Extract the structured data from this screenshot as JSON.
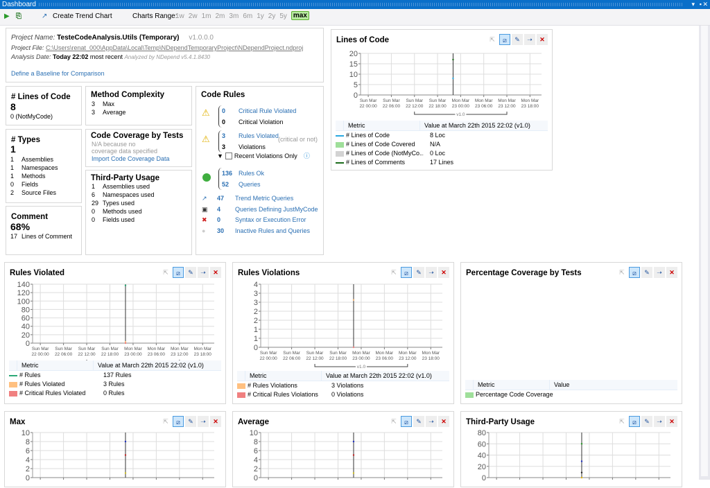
{
  "window": {
    "title": "Dashboard"
  },
  "toolbar": {
    "create_trend_chart": "Create Trend Chart",
    "charts_range_label": "Charts Range:",
    "ranges": [
      "1w",
      "2w",
      "1m",
      "2m",
      "3m",
      "6m",
      "1y",
      "2y",
      "5y",
      "max"
    ],
    "active_range": "max"
  },
  "project": {
    "name_label": "Project Name:",
    "name": "TesteCodeAnalysis.Utils (Temporary)",
    "version": "v1.0.0.0",
    "file_label": "Project File:",
    "file": "C:\\Users\\renat_000\\AppData\\Local\\Temp\\NDependTemporaryProject\\NDependProject.ndproj",
    "date_label": "Analysis Date:",
    "date": "Today 22:02",
    "recent": "most recent",
    "analyzed_by": "Analyzed by NDepend v5.4.1.8430",
    "baseline_link": "Define a Baseline for Comparison"
  },
  "loc": {
    "title": "# Lines of Code",
    "value": "8",
    "sub": "0  (NotMyCode)"
  },
  "types": {
    "title": "# Types",
    "value": "1",
    "rows": [
      [
        "1",
        "Assemblies"
      ],
      [
        "1",
        "Namespaces"
      ],
      [
        "1",
        "Methods"
      ],
      [
        "0",
        "Fields"
      ],
      [
        "2",
        "Source Files"
      ]
    ]
  },
  "comment": {
    "title": "Comment",
    "value": "68%",
    "rows": [
      [
        "17",
        "Lines of Comment"
      ]
    ]
  },
  "complexity": {
    "title": "Method Complexity",
    "rows": [
      [
        "3",
        "Max"
      ],
      [
        "3",
        "Average"
      ]
    ]
  },
  "coverage": {
    "title": "Code Coverage by Tests",
    "na": "N/A because no coverage data specified",
    "link": "Import Code Coverage Data"
  },
  "thirdparty": {
    "title": "Third-Party Usage",
    "rows": [
      [
        "1",
        "Assemblies used"
      ],
      [
        "6",
        "Namespaces used"
      ],
      [
        "29",
        "Types used"
      ],
      [
        "0",
        "Methods used"
      ],
      [
        "0",
        "Fields used"
      ]
    ]
  },
  "rules": {
    "title": "Code Rules",
    "critical": [
      [
        "0",
        "Critical Rule Violated"
      ],
      [
        "0",
        "Critical Violation"
      ]
    ],
    "violated": [
      [
        "3",
        "Rules Violated"
      ],
      [
        "3",
        "Violations"
      ]
    ],
    "critical_or_not": "(critical or not)",
    "recent_only": "Recent Violations Only",
    "recent_checked": false,
    "ok": [
      [
        "136",
        "Rules Ok"
      ],
      [
        "52",
        "Queries"
      ]
    ],
    "others": [
      {
        "icon": "trend-icon",
        "n": "47",
        "label": "Trend Metric Queries"
      },
      {
        "icon": "justmycode-icon",
        "n": "4",
        "label": "Queries Defining JustMyCode"
      },
      {
        "icon": "error-icon",
        "n": "0",
        "label": "Syntax or Execution Error"
      },
      {
        "icon": "inactive-icon",
        "n": "30",
        "label": "Inactive Rules and Queries"
      }
    ]
  },
  "table_headers": {
    "metric": "Metric",
    "value_at": "Value at March 22th 2015  22:02  (v1.0)",
    "value": "Value"
  },
  "chart_data": [
    {
      "type": "scatter",
      "title": "Lines of Code",
      "ylim": [
        0,
        20
      ],
      "yticks": [
        "0",
        "5",
        "10",
        "15",
        "20"
      ],
      "xlim": [
        "2015-03-21T22:00",
        "2015-03-23T21:00"
      ],
      "xticks": [
        "Sun Mar|22  00:00",
        "Sun Mar|22  06:00",
        "Sun Mar|22  12:00",
        "Sun Mar|22  18:00",
        "Mon Mar|23  00:00",
        "Mon Mar|23  06:00",
        "Mon Mar|23  12:00",
        "Mon Mar|23  18:00"
      ],
      "version_label": "v1.0",
      "analysis_x": "2015-03-22T22:02",
      "series": [
        {
          "name": "# Lines of Code",
          "color": "#29a8e0",
          "swatch": "line",
          "value_text": "8 Loc",
          "points": [
            [
              "2015-03-22T22:02",
              8
            ]
          ]
        },
        {
          "name": "# Lines of Code Covered",
          "color": "#9fdf9a",
          "swatch": "box",
          "value_text": "N/A",
          "points": []
        },
        {
          "name": "# Lines of Code (NotMyCo...",
          "color": "#d3d3d3",
          "swatch": "box",
          "value_text": "0 Loc",
          "points": []
        },
        {
          "name": "# Lines of Comments",
          "color": "#1a6b1a",
          "swatch": "line",
          "value_text": "17 Lines",
          "points": [
            [
              "2015-03-22T22:02",
              17
            ]
          ]
        }
      ]
    },
    {
      "type": "scatter",
      "title": "Rules Violated",
      "ylim": [
        0,
        140
      ],
      "yticks": [
        "0",
        "20",
        "40",
        "60",
        "80",
        "100",
        "120",
        "140"
      ],
      "xlim": [
        "2015-03-21T22:00",
        "2015-03-23T21:00"
      ],
      "xticks": [
        "Sun Mar|22  00:00",
        "Sun Mar|22  06:00",
        "Sun Mar|22  12:00",
        "Sun Mar|22  18:00",
        "Mon Mar|23  00:00",
        "Mon Mar|23  06:00",
        "Mon Mar|23  12:00",
        "Mon Mar|23  18:00"
      ],
      "version_label": "v1.0",
      "analysis_x": "2015-03-22T22:02",
      "series": [
        {
          "name": "# Rules",
          "color": "#2aa876",
          "swatch": "line",
          "value_text": "137 Rules",
          "points": [
            [
              "2015-03-22T22:02",
              137
            ]
          ]
        },
        {
          "name": "# Rules Violated",
          "color": "#ffc080",
          "swatch": "box",
          "value_text": "3 Rules",
          "points": [
            [
              "2015-03-22T22:02",
              3
            ]
          ]
        },
        {
          "name": "# Critical Rules Violated",
          "color": "#f08080",
          "swatch": "box",
          "value_text": "0 Rules",
          "points": [
            [
              "2015-03-22T22:02",
              0
            ]
          ]
        }
      ]
    },
    {
      "type": "scatter",
      "title": "Rules Violations",
      "ylim": [
        0,
        4
      ],
      "yticks": [
        "0",
        "1",
        "1",
        "2",
        "2",
        "3",
        "3",
        "4"
      ],
      "xlim": [
        "2015-03-21T22:00",
        "2015-03-23T21:00"
      ],
      "xticks": [
        "Sun Mar|22  00:00",
        "Sun Mar|22  06:00",
        "Sun Mar|22  12:00",
        "Sun Mar|22  18:00",
        "Mon Mar|23  00:00",
        "Mon Mar|23  06:00",
        "Mon Mar|23  12:00",
        "Mon Mar|23  18:00"
      ],
      "version_label": "v1.0",
      "analysis_x": "2015-03-22T22:02",
      "series": [
        {
          "name": "# Rules Violations",
          "color": "#ffc080",
          "swatch": "box",
          "value_text": "3 Violations",
          "points": [
            [
              "2015-03-22T22:02",
              3
            ]
          ]
        },
        {
          "name": "# Critical Rules Violations",
          "color": "#f08080",
          "swatch": "box",
          "value_text": "0 Violations",
          "points": [
            [
              "2015-03-22T22:02",
              0
            ]
          ]
        }
      ]
    },
    {
      "type": "scatter",
      "title": "Percentage Coverage by Tests",
      "empty": true,
      "series": [
        {
          "name": "Percentage Code Coverage",
          "color": "#9fdf9a",
          "swatch": "box",
          "value_text": "",
          "points": []
        }
      ]
    },
    {
      "type": "scatter",
      "title": "Max",
      "ylim": [
        0,
        10
      ],
      "yticks": [
        "0",
        "2",
        "4",
        "6",
        "8",
        "10"
      ],
      "xlim": [
        "2015-03-21T22:00",
        "2015-03-23T21:00"
      ],
      "analysis_x": "2015-03-22T22:02",
      "series": [
        {
          "color": "#1f2fbf",
          "points": [
            [
              "2015-03-22T22:02",
              8
            ]
          ]
        },
        {
          "color": "#c02020",
          "points": [
            [
              "2015-03-22T22:02",
              5
            ]
          ]
        },
        {
          "color": "#d0c020",
          "points": [
            [
              "2015-03-22T22:02",
              1
            ]
          ]
        }
      ]
    },
    {
      "type": "scatter",
      "title": "Average",
      "ylim": [
        0,
        10
      ],
      "yticks": [
        "0",
        "2",
        "4",
        "6",
        "8",
        "10"
      ],
      "xlim": [
        "2015-03-21T22:00",
        "2015-03-23T21:00"
      ],
      "analysis_x": "2015-03-22T22:02",
      "series": [
        {
          "color": "#1f2fbf",
          "points": [
            [
              "2015-03-22T22:02",
              8
            ]
          ]
        },
        {
          "color": "#c02020",
          "points": [
            [
              "2015-03-22T22:02",
              5
            ]
          ]
        },
        {
          "color": "#d0c020",
          "points": [
            [
              "2015-03-22T22:02",
              1
            ]
          ]
        }
      ]
    },
    {
      "type": "scatter",
      "title": "Third-Party Usage",
      "ylim": [
        0,
        80
      ],
      "yticks": [
        "0",
        "20",
        "40",
        "60",
        "80"
      ],
      "xlim": [
        "2015-03-21T22:00",
        "2015-03-23T21:00"
      ],
      "analysis_x": "2015-03-22T22:02",
      "series": [
        {
          "color": "#2a9a2a",
          "points": [
            [
              "2015-03-22T22:02",
              60
            ]
          ]
        },
        {
          "color": "#1f2fbf",
          "points": [
            [
              "2015-03-22T22:02",
              29
            ]
          ]
        },
        {
          "color": "#222222",
          "points": [
            [
              "2015-03-22T22:02",
              9
            ]
          ]
        },
        {
          "color": "#e0b000",
          "points": [
            [
              "2015-03-22T22:02",
              0
            ]
          ]
        }
      ]
    }
  ]
}
